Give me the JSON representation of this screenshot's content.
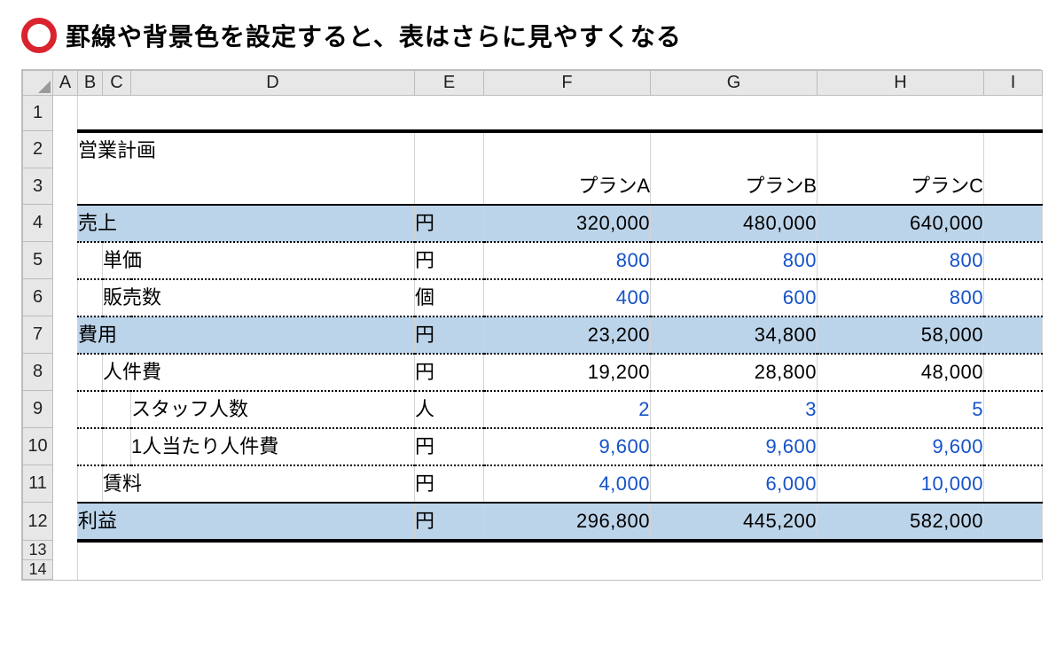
{
  "headline": "罫線や背景色を設定すると、表はさらに見やすくなる",
  "columns": [
    "A",
    "B",
    "C",
    "D",
    "E",
    "F",
    "G",
    "H",
    "I"
  ],
  "row_numbers": [
    "1",
    "2",
    "3",
    "4",
    "5",
    "6",
    "7",
    "8",
    "9",
    "10",
    "11",
    "12",
    "13",
    "14"
  ],
  "sheet": {
    "title": "営業計画",
    "plan_headers": {
      "F": "プランA",
      "G": "プランB",
      "H": "プランC"
    },
    "rows": [
      {
        "key": "sales",
        "label": "売上",
        "unit": "円",
        "F": "320,000",
        "G": "480,000",
        "H": "640,000",
        "hl": true,
        "indent": 0,
        "blue": false
      },
      {
        "key": "price",
        "label": "単価",
        "unit": "円",
        "F": "800",
        "G": "800",
        "H": "800",
        "hl": false,
        "indent": 1,
        "blue": true
      },
      {
        "key": "qty",
        "label": "販売数",
        "unit": "個",
        "F": "400",
        "G": "600",
        "H": "800",
        "hl": false,
        "indent": 1,
        "blue": true
      },
      {
        "key": "cost",
        "label": "費用",
        "unit": "円",
        "F": "23,200",
        "G": "34,800",
        "H": "58,000",
        "hl": true,
        "indent": 0,
        "blue": false
      },
      {
        "key": "labor",
        "label": "人件費",
        "unit": "円",
        "F": "19,200",
        "G": "28,800",
        "H": "48,000",
        "hl": false,
        "indent": 1,
        "blue": false
      },
      {
        "key": "staff",
        "label": "スタッフ人数",
        "unit": "人",
        "F": "2",
        "G": "3",
        "H": "5",
        "hl": false,
        "indent": 2,
        "blue": true
      },
      {
        "key": "percap",
        "label": "1人当たり人件費",
        "unit": "円",
        "F": "9,600",
        "G": "9,600",
        "H": "9,600",
        "hl": false,
        "indent": 2,
        "blue": true
      },
      {
        "key": "rent",
        "label": "賃料",
        "unit": "円",
        "F": "4,000",
        "G": "6,000",
        "H": "10,000",
        "hl": false,
        "indent": 1,
        "blue": true
      },
      {
        "key": "profit",
        "label": "利益",
        "unit": "円",
        "F": "296,800",
        "G": "445,200",
        "H": "582,000",
        "hl": true,
        "indent": 0,
        "blue": false
      }
    ]
  }
}
